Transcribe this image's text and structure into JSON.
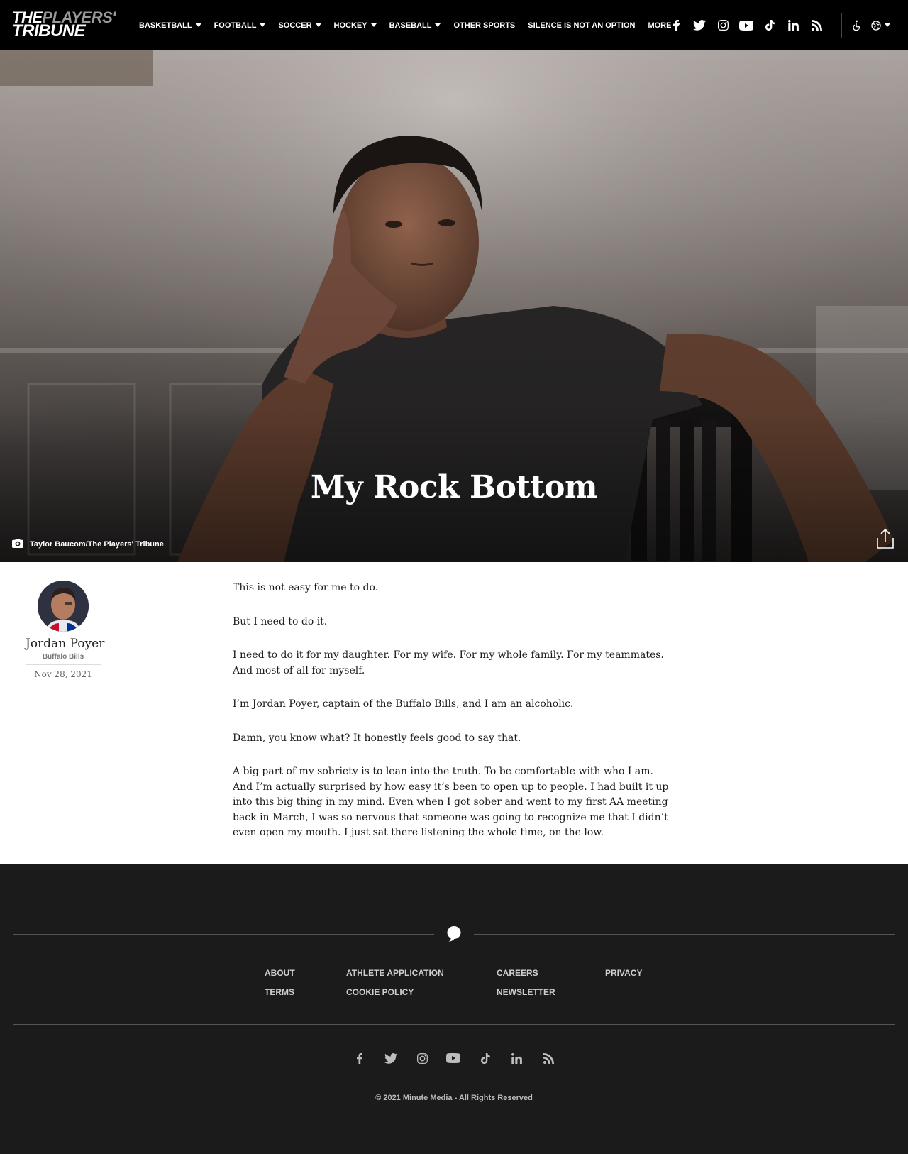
{
  "brand": {
    "logo_line1_the": "THE",
    "logo_line1_players": "PLAYERS'",
    "logo_line2": "TRIBUNE"
  },
  "nav": {
    "items": [
      {
        "label": "BASKETBALL",
        "dropdown": true
      },
      {
        "label": "FOOTBALL",
        "dropdown": true
      },
      {
        "label": "SOCCER",
        "dropdown": true
      },
      {
        "label": "HOCKEY",
        "dropdown": true
      },
      {
        "label": "BASEBALL",
        "dropdown": true
      },
      {
        "label": "OTHER SPORTS",
        "dropdown": false
      },
      {
        "label": "SILENCE IS NOT AN OPTION",
        "dropdown": false
      },
      {
        "label": "MORE",
        "dropdown": true
      }
    ],
    "social_icons": [
      "facebook-icon",
      "twitter-icon",
      "instagram-icon",
      "youtube-icon",
      "tiktok-icon",
      "linkedin-icon",
      "rss-icon"
    ],
    "accessibility_icon": "accessibility-icon",
    "language_icon": "globe-icon"
  },
  "hero": {
    "title": "My Rock Bottom",
    "photo_credit": "Taylor Baucom/The Players' Tribune",
    "credit_icon": "camera-icon",
    "share_icon": "share-icon"
  },
  "author": {
    "name": "Jordan Poyer",
    "team": "Buffalo Bills",
    "date": "Nov 28, 2021"
  },
  "article": {
    "paragraphs": [
      "This is not easy for me to do.",
      "But I need to do it.",
      "I need to do it for my daughter. For my wife. For my whole family. For my teammates. And most of all for myself.",
      "I’m Jordan Poyer, captain of the Buffalo Bills, and I am an alcoholic.",
      "Damn, you know what? It honestly feels good to say that.",
      "A big part of my sobriety is to lean into the truth. To be comfortable with who I am. And I’m actually surprised by how easy it’s been to open up to people. I had built it up into this big thing in my mind. Even when I got sober and went to my first AA meeting back in March, I was so nervous that someone was going to recognize me that I didn’t even open my mouth. I just sat there listening the whole time, on the low."
    ]
  },
  "footer": {
    "links": {
      "about": "ABOUT",
      "terms": "TERMS",
      "athlete_application": "ATHLETE APPLICATION",
      "cookie_policy": "COOKIE POLICY",
      "careers": "CAREERS",
      "newsletter": "NEWSLETTER",
      "privacy": "PRIVACY"
    },
    "social_icons": [
      "facebook-icon",
      "twitter-icon",
      "instagram-icon",
      "youtube-icon",
      "tiktok-icon",
      "linkedin-icon",
      "rss-icon"
    ],
    "copyright": "© 2021 Minute Media - All Rights Reserved"
  },
  "colors": {
    "nav_bg": "#000000",
    "footer_bg": "#1b1b1b",
    "footer_text": "#cfcfcf",
    "body_bg": "#ffffff"
  }
}
